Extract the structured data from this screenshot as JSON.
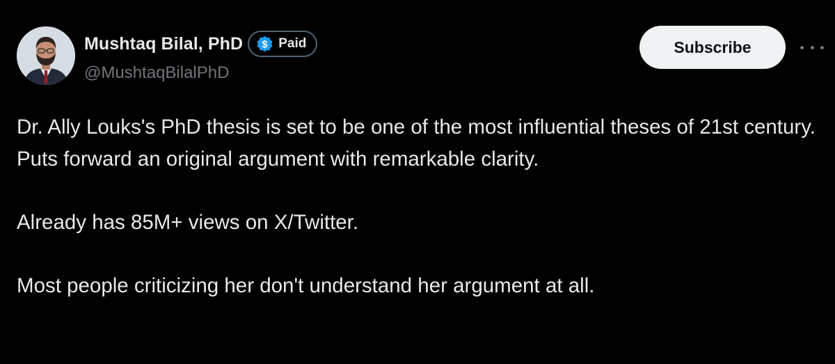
{
  "author": {
    "display_name": "Mushtaq Bilal, PhD",
    "handle": "@MushtaqBilalPhD",
    "badge_label": "Paid",
    "badge_icon": "dollar-icon",
    "badge_color": "#1d9bf0",
    "avatar_icon": "avatar-photo"
  },
  "actions": {
    "subscribe_label": "Subscribe",
    "more_icon": "more-horizontal-icon"
  },
  "post": {
    "paragraphs": [
      "Dr. Ally Louks's PhD thesis is set to be one of the most influential theses of 21st century. Puts forward an original argument with remarkable clarity.",
      "Already has 85M+ views on X/Twitter.",
      "Most people criticizing her don't understand her argument at all."
    ]
  },
  "colors": {
    "background": "#000000",
    "primary_text": "#e7e9ea",
    "secondary_text": "#71767b",
    "button_bg": "#eff3f4",
    "button_text": "#0f1419"
  }
}
